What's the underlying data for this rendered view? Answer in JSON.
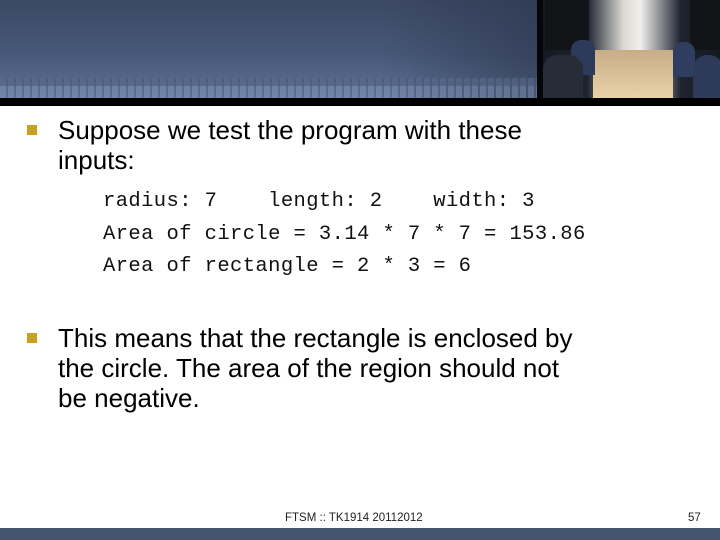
{
  "slide": {
    "bullets": [
      {
        "text_line1": "Suppose we test the program with these",
        "text_line2": "inputs:"
      },
      {
        "text_line1": "This means that the rectangle is enclosed by",
        "text_line2": "the circle.  The area of the region should not",
        "text_line3": "be negative."
      }
    ],
    "code_lines": [
      "radius: 7    length: 2    width: 3",
      "Area of circle = 3.14 * 7 * 7 = 153.86",
      "Area of rectangle = 2 * 3 = 6"
    ],
    "colors": {
      "bullet": "#c8a022",
      "header": "#475878",
      "footer_band": "#465470"
    }
  },
  "footer": {
    "course_label": "FTSM :: TK1914 20112012",
    "page_number": "57"
  }
}
